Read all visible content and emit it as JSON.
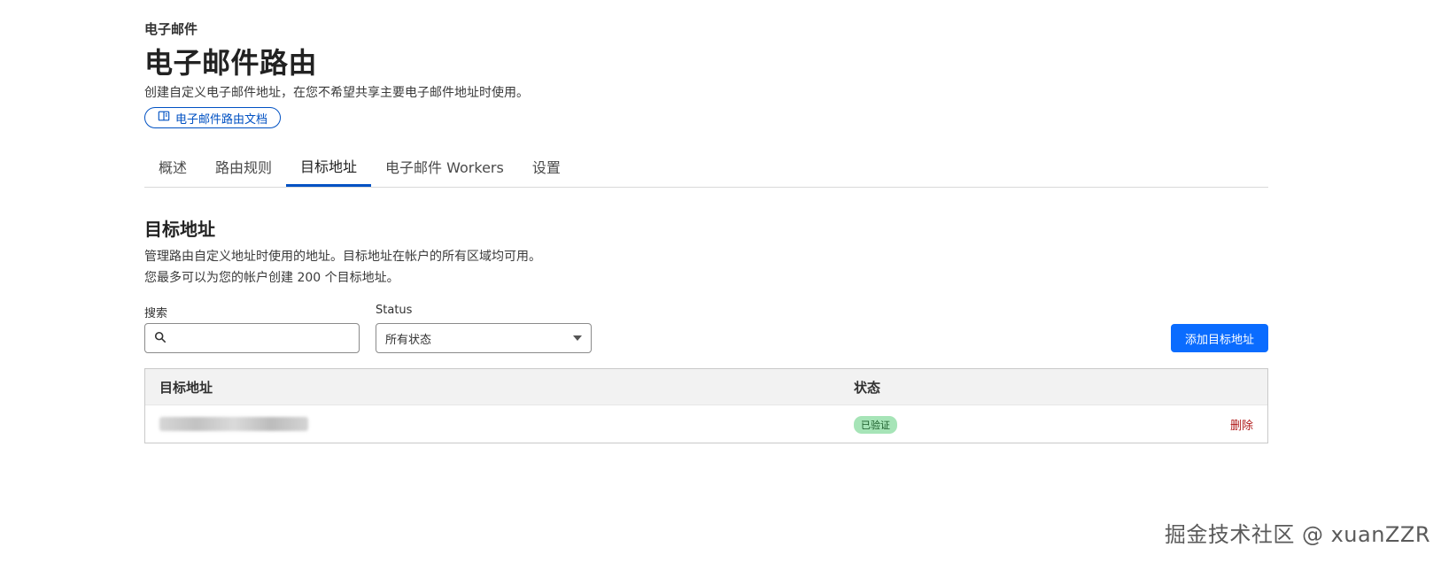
{
  "header": {
    "breadcrumb": "电子邮件",
    "title": "电子邮件路由",
    "description": "创建自定义电子邮件地址，在您不希望共享主要电子邮件地址时使用。",
    "doc_link_label": "电子邮件路由文档"
  },
  "tabs": [
    {
      "label": "概述",
      "active": false
    },
    {
      "label": "路由规则",
      "active": false
    },
    {
      "label": "目标地址",
      "active": true
    },
    {
      "label": "电子邮件 Workers",
      "active": false
    },
    {
      "label": "设置",
      "active": false
    }
  ],
  "section": {
    "title": "目标地址",
    "desc_line1": "管理路由自定义地址时使用的地址。目标地址在帐户的所有区域均可用。",
    "desc_line2": "您最多可以为您的帐户创建 200 个目标地址。"
  },
  "filters": {
    "search_label": "搜索",
    "search_value": "",
    "status_label": "Status",
    "status_selected": "所有状态"
  },
  "add_button_label": "添加目标地址",
  "table": {
    "columns": [
      "目标地址",
      "状态"
    ],
    "rows": [
      {
        "status": "已验证",
        "action": "删除"
      }
    ]
  },
  "watermark": "掘金技术社区 @ xuanZZR",
  "colors": {
    "accent": "#0051c3",
    "primary_button": "#0a6cff",
    "verified_badge": "#a6e4b7",
    "danger": "#b01a1a"
  }
}
